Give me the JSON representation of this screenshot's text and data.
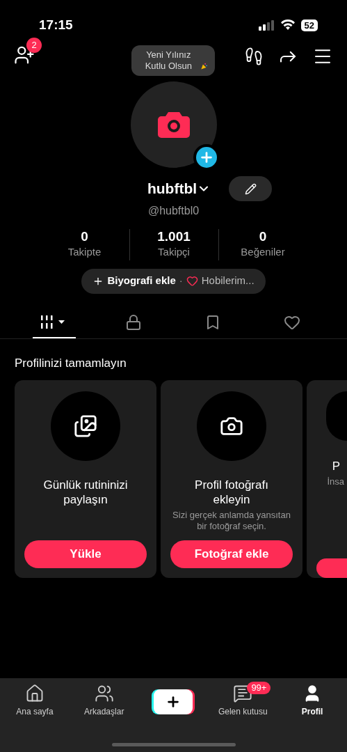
{
  "status_bar": {
    "time": "17:15",
    "battery": "52"
  },
  "header": {
    "friend_requests_badge": "2"
  },
  "avatar": {
    "greeting": "Yeni Yılınız Kutlu Olsun"
  },
  "profile": {
    "name": "hubftbl",
    "handle": "@hubftbl0"
  },
  "stats": [
    {
      "value": "0",
      "label": "Takipte"
    },
    {
      "value": "1.001",
      "label": "Takipçi"
    },
    {
      "value": "0",
      "label": "Beğeniler"
    }
  ],
  "bio": {
    "add_label": "Biyografi ekle",
    "separator": "·",
    "hobbies_label": "Hobilerim..."
  },
  "tabs": [
    {
      "kind": "videos",
      "selected": true
    },
    {
      "kind": "private",
      "selected": false
    },
    {
      "kind": "saved",
      "selected": false
    },
    {
      "kind": "liked",
      "selected": false
    }
  ],
  "complete_section": {
    "title": "Profilinizi tamamlayın",
    "cards": [
      {
        "kind": "photos",
        "title": "Günlük rutininizi paylaşın",
        "button": "Yükle"
      },
      {
        "kind": "camera",
        "title": "Profil fotoğrafı ekleyin",
        "description": "Sizi gerçek anlamda yansıtan bir fotoğraf seçin.",
        "button": "Fotoğraf ekle"
      },
      {
        "kind": "partial",
        "title": "P",
        "description": "İnsa"
      }
    ]
  },
  "bottom_nav": [
    {
      "kind": "home",
      "label": "Ana sayfa",
      "selected": false
    },
    {
      "kind": "friends",
      "label": "Arkadaşlar",
      "selected": false
    },
    {
      "kind": "create"
    },
    {
      "kind": "inbox",
      "label": "Gelen kutusu",
      "badge": "99+",
      "selected": false
    },
    {
      "kind": "profile",
      "label": "Profil",
      "selected": true
    }
  ]
}
